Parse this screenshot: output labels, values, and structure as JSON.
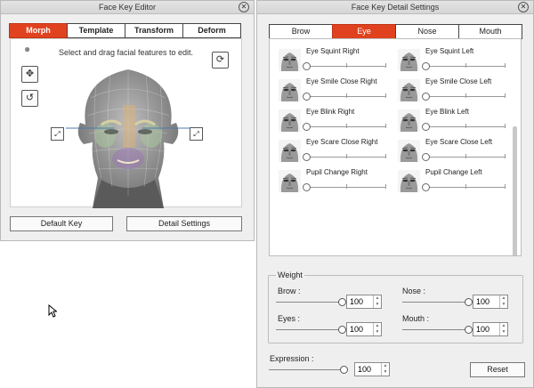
{
  "editor": {
    "title": "Face Key Editor",
    "tabs": [
      "Morph",
      "Template",
      "Transform",
      "Deform"
    ],
    "active_tab": "Morph",
    "hint": "Select and drag facial features to edit.",
    "buttons": {
      "default_key": "Default Key",
      "detail_settings": "Detail Settings"
    },
    "icons": [
      "head-pin-icon",
      "orbit-icon",
      "rotate-icon",
      "reset-view-icon",
      "expand-left-icon",
      "expand-right-icon"
    ]
  },
  "detail": {
    "title": "Face Key Detail Settings",
    "tabs": [
      "Brow",
      "Eye",
      "Nose",
      "Mouth"
    ],
    "active_tab": "Eye",
    "items": [
      {
        "label": "Eye Squint Right",
        "value": 0
      },
      {
        "label": "Eye Squint Left",
        "value": 0
      },
      {
        "label": "Eye Smile Close Right",
        "value": 0
      },
      {
        "label": "Eye Smile Close Left",
        "value": 0
      },
      {
        "label": "Eye Blink Right",
        "value": 0
      },
      {
        "label": "Eye Blink Left",
        "value": 0
      },
      {
        "label": "Eye Scare Close Right",
        "value": 0
      },
      {
        "label": "Eye Scare Close Left",
        "value": 0
      },
      {
        "label": "Pupil Change Right",
        "value": 0
      },
      {
        "label": "Pupil Change Left",
        "value": 0
      }
    ],
    "weight": {
      "title": "Weight",
      "brow": {
        "label": "Brow :",
        "value": "100"
      },
      "nose": {
        "label": "Nose :",
        "value": "100"
      },
      "eyes": {
        "label": "Eyes :",
        "value": "100"
      },
      "mouth": {
        "label": "Mouth :",
        "value": "100"
      }
    },
    "expression": {
      "label": "Expression :",
      "value": "100"
    },
    "reset": "Reset"
  },
  "colors": {
    "accent": "#e0421f",
    "panel": "#efefef"
  }
}
